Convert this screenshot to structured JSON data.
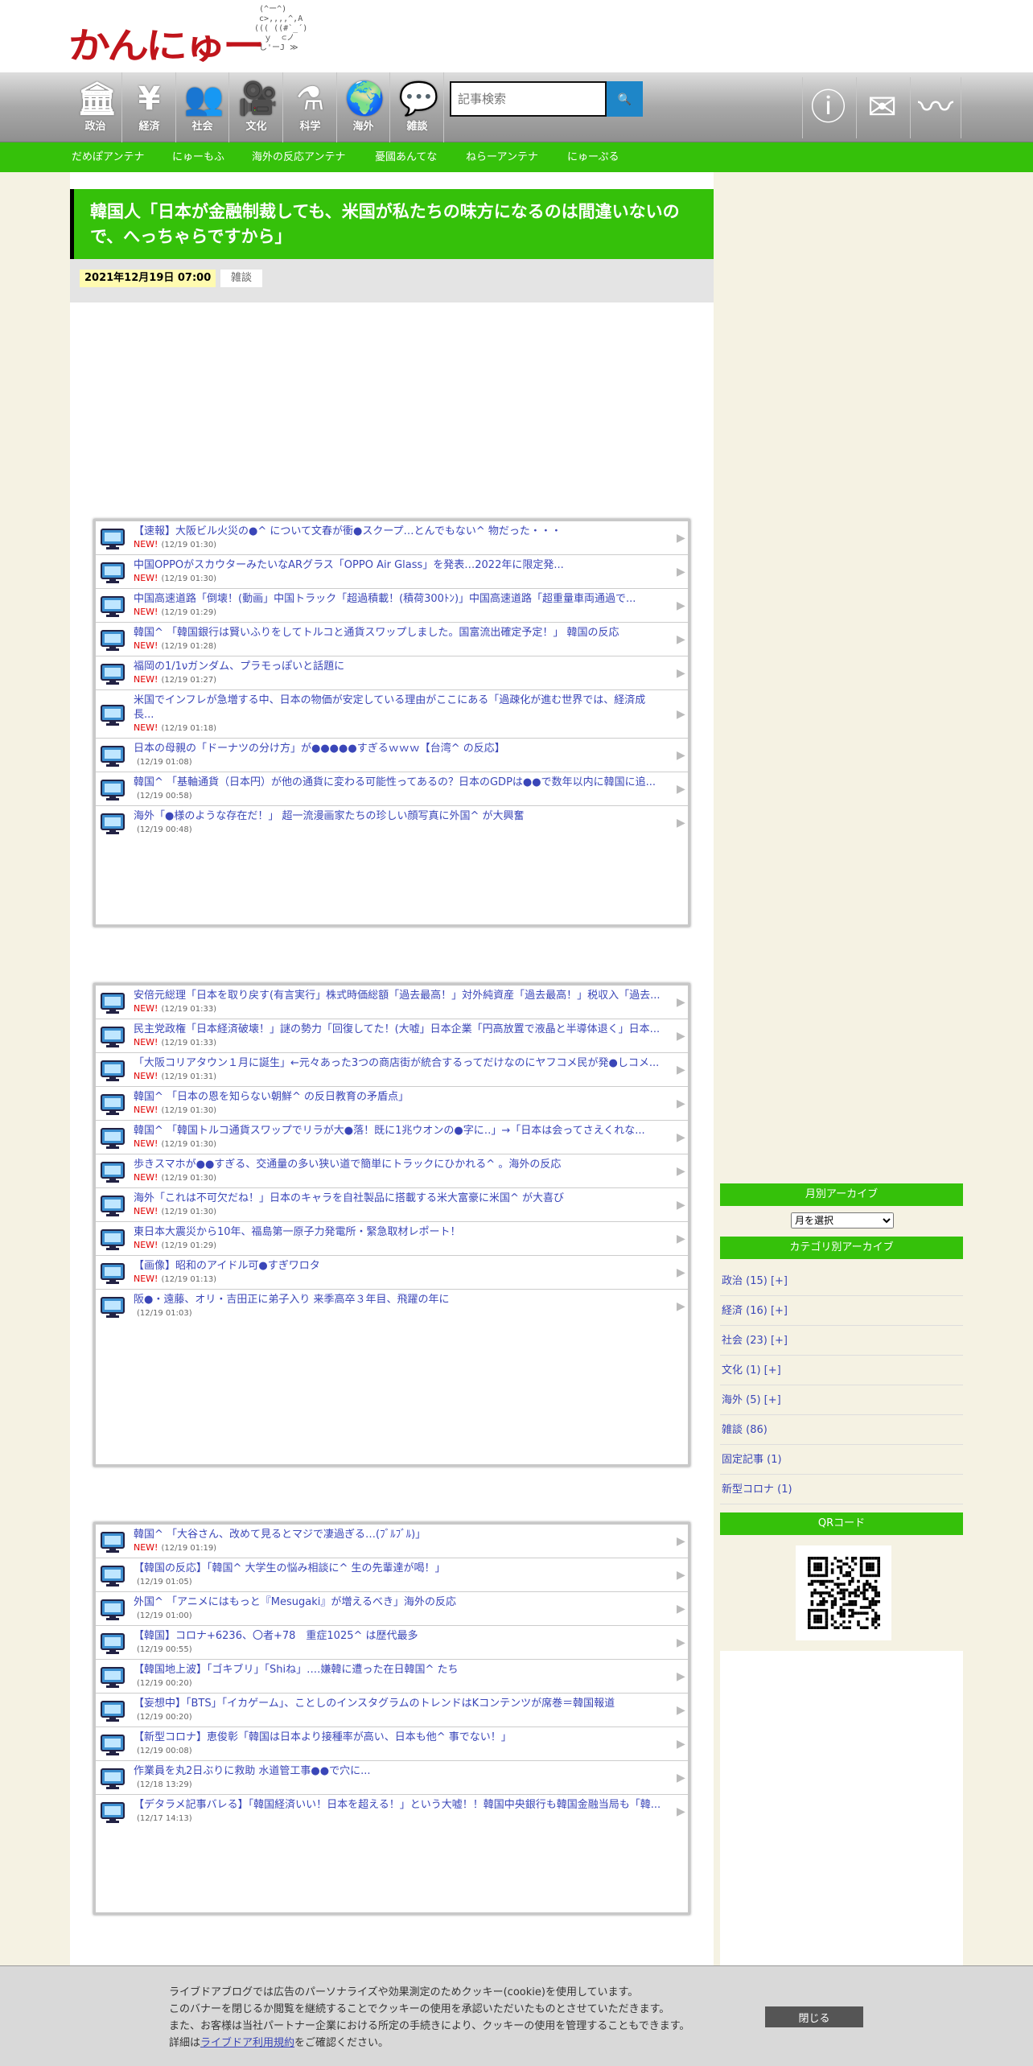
{
  "header": {
    "logo_text": "かんにゅー",
    "logo_art": "  (^ー^)\n  c>,,,,^,A\n ((( ((#`_´)\n   ｙ  ⊂ノ\n  し'ーJ ≫"
  },
  "nav": {
    "categories": [
      {
        "label": "政治",
        "icon": "capitol-icon",
        "glyph": "🏛"
      },
      {
        "label": "経済",
        "icon": "coins-icon",
        "glyph": "¥"
      },
      {
        "label": "社会",
        "icon": "people-icon",
        "glyph": "👥"
      },
      {
        "label": "文化",
        "icon": "camera-icon",
        "glyph": "🎥"
      },
      {
        "label": "科学",
        "icon": "flask-icon",
        "glyph": "⚗"
      },
      {
        "label": "海外",
        "icon": "globe-icon",
        "glyph": "🌍"
      },
      {
        "label": "雑談",
        "icon": "chat-icon",
        "glyph": "💬"
      }
    ],
    "search_placeholder": "記事検索",
    "search_button": "🔍"
  },
  "antenna": [
    "だめぽアンテナ",
    "にゅーもふ",
    "海外の反応アンテナ",
    "憂國あんてな",
    "ねらーアンテナ",
    "にゅーぷる"
  ],
  "article": {
    "title": "韓国人「日本が金融制裁しても、米国が私たちの味方になるのは間違いないので、へっちゃらですから」",
    "date": "2021年12月19日 07:00",
    "category": "雑談"
  },
  "feeds": [
    [
      {
        "title": "【速報】大阪ビル火災の●^ について文春が衝●スクープ…とんでもない^ 物だった・・・",
        "new": "NEW!",
        "time": "(12/19 01:30)"
      },
      {
        "title": "中国OPPOがスカウターみたいなARグラス「OPPO Air Glass」を発表…2022年に限定発...",
        "new": "NEW!",
        "time": "(12/19 01:30)"
      },
      {
        "title": "中国高速道路「倒壊！(動画」中国トラック「超過積載！(積荷300ﾄﾝ)」中国高速道路「超重量車両通過で...",
        "new": "NEW!",
        "time": "(12/19 01:29)"
      },
      {
        "title": "韓国^ 「韓国銀行は賢いふりをしてトルコと通貨スワップしました。国富流出確定予定！」 韓国の反応",
        "new": "NEW!",
        "time": "(12/19 01:28)"
      },
      {
        "title": "福岡の1/1νガンダム、プラモっぽいと話題に",
        "new": "NEW!",
        "time": "(12/19 01:27)"
      },
      {
        "title": "米国でインフレが急増する中、日本の物価が安定している理由がここにある「過疎化が進む世界では、経済成長...",
        "new": "NEW!",
        "time": "(12/19 01:18)"
      },
      {
        "title": "日本の母親の「ドーナツの分け方」が●●●●●すぎるｗｗｗ【台湾^ の反応】",
        "new": "",
        "time": "(12/19 01:08)"
      },
      {
        "title": "韓国^ 「基軸通貨（日本円）が他の通貨に変わる可能性ってあるの？日本のGDPは●●で数年以内に韓国に追...",
        "new": "",
        "time": "(12/19 00:58)"
      },
      {
        "title": "海外「●様のような存在だ！」 超一流漫画家たちの珍しい顔写真に外国^ が大興奮",
        "new": "",
        "time": "(12/19 00:48)"
      }
    ],
    [
      {
        "title": "安倍元総理「日本を取り戻す(有言実行」株式時価総額「過去最高！」対外純資産「過去最高！」税収入「過去...",
        "new": "NEW!",
        "time": "(12/19 01:33)"
      },
      {
        "title": "民主党政権「日本経済破壊！」謎の勢力「回復してた！(大嘘」日本企業「円高放置で液晶と半導体退く」日本...",
        "new": "NEW!",
        "time": "(12/19 01:33)"
      },
      {
        "title": "「大阪コリアタウン１月に誕生」←元々あった3つの商店街が統合するってだけなのにヤフコメ民が発●しコメ...",
        "new": "NEW!",
        "time": "(12/19 01:31)"
      },
      {
        "title": "韓国^ 「日本の恩を知らない朝鮮^ の反日教育の矛盾点」",
        "new": "NEW!",
        "time": "(12/19 01:30)"
      },
      {
        "title": "韓国^ 「韓国トルコ通貨スワップでリラが大●落！既に1兆ウオンの●字に‥」→「日本は会ってさえくれな...",
        "new": "NEW!",
        "time": "(12/19 01:30)"
      },
      {
        "title": "歩きスマホが●●すぎる、交通量の多い狭い道で簡単にトラックにひかれる^ 。海外の反応",
        "new": "NEW!",
        "time": "(12/19 01:30)"
      },
      {
        "title": "海外「これは不可欠だね！」日本のキャラを自社製品に搭載する米大富豪に米国^ が大喜び",
        "new": "NEW!",
        "time": "(12/19 01:30)"
      },
      {
        "title": "東日本大震災から10年、福島第一原子力発電所・緊急取材レポート！",
        "new": "NEW!",
        "time": "(12/19 01:29)"
      },
      {
        "title": "【画像】昭和のアイドル可●すぎワロタ",
        "new": "NEW!",
        "time": "(12/19 01:13)"
      },
      {
        "title": "阪●・遠藤、オリ・吉田正に弟子入り 来季高卒３年目、飛躍の年に",
        "new": "",
        "time": "(12/19 01:03)"
      }
    ],
    [
      {
        "title": "韓国^ 「大谷さん、改めて見るとマジで凄過ぎる…(ﾌﾞﾙﾌﾞﾙ)」",
        "new": "NEW!",
        "time": "(12/19 01:19)"
      },
      {
        "title": "【韓国の反応】「韓国^ 大学生の悩み相談に^ 生の先輩達が喝！」",
        "new": "",
        "time": "(12/19 01:05)"
      },
      {
        "title": "外国^ 「アニメにはもっと『Mesugaki』が増えるべき」海外の反応",
        "new": "",
        "time": "(12/19 01:00)"
      },
      {
        "title": "【韓国】コロナ+6236、〇者+78　重症1025^ は歴代最多",
        "new": "",
        "time": "(12/19 00:55)"
      },
      {
        "title": "【韓国地上波】「ゴキブリ」「Shiね」‥‥嫌韓に遭った在日韓国^ たち",
        "new": "",
        "time": "(12/19 00:20)"
      },
      {
        "title": "【妄想中】「BTS」「イカゲーム」、ことしのインスタグラムのトレンドはKコンテンツが席巻＝韓国報道",
        "new": "",
        "time": "(12/19 00:20)"
      },
      {
        "title": "【新型コロナ】恵俊彰「韓国は日本より接種率が高い、日本も他^ 事でない！」",
        "new": "",
        "time": "(12/19 00:08)"
      },
      {
        "title": "作業員を丸2日ぶりに救助 水道管工事●●で穴に...",
        "new": "",
        "time": "(12/18 13:29)"
      },
      {
        "title": "【デタラメ記事バレる】「韓国経済いい！日本を超える！」という大嘘！！韓国中央銀行も韓国金融当局も「韓...",
        "new": "",
        "time": "(12/17 14:13)"
      }
    ]
  ],
  "sidebar": {
    "monthly_heading": "月別アーカイブ",
    "month_select": "月を選択",
    "category_heading": "カテゴリ別アーカイブ",
    "categories": [
      "政治 (15) [+]",
      "経済 (16) [+]",
      "社会 (23) [+]",
      "文化 (1) [+]",
      "海外 (5) [+]",
      "雑談 (86)",
      "固定記事 (1)",
      "新型コロナ (1)"
    ],
    "qr_heading": "QRコード"
  },
  "cookie": {
    "line1": "ライブドアブログでは広告のパーソナライズや効果測定のためクッキー(cookie)を使用しています。",
    "line2": "このバナーを閉じるか閲覧を継続することでクッキーの使用を承認いただいたものとさせていただきます。",
    "line3": "また、お客様は当社パートナー企業における所定の手続きにより、クッキーの使用を管理することもできます。",
    "line4_pre": "詳細は",
    "line4_link": "ライブドア利用規約",
    "line4_post": "をご確認ください。",
    "close_label": "閉じる"
  },
  "colors": {
    "accent_green": "#35c10a",
    "link_blue": "#3a46b8",
    "logo_red": "#c0141b",
    "new_red": "#e00000",
    "search_blue": "#1e86c8"
  }
}
